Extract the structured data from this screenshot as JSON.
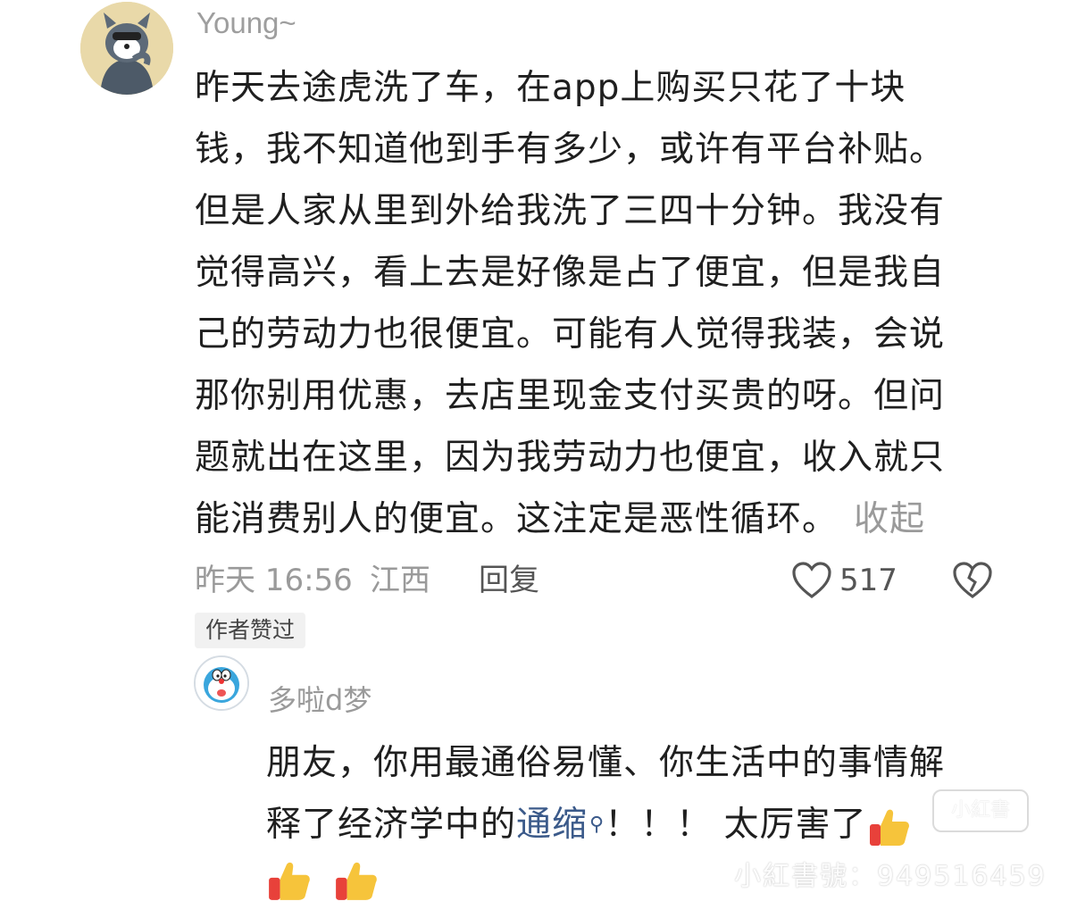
{
  "comment": {
    "username": "Young~",
    "lines": [
      "昨天去途虎洗了车，在app上购买只花了十块",
      "钱，我不知道他到手有多少，或许有平台补贴。",
      "但是人家从里到外给我洗了三四十分钟。我没有",
      "觉得高兴，看上去是好像是占了便宜，但是我自",
      "己的劳动力也很便宜。可能有人觉得我装，会说",
      "那你别用优惠，去店里现金支付买贵的呀。但问",
      "题就出在这里，因为我劳动力也便宜，收入就只",
      "能消费别人的便宜。这注定是恶性循环。"
    ],
    "collapse_label": "收起",
    "time": "昨天 16:56",
    "location": "江西",
    "reply_label": "回复",
    "like_count": "517",
    "author_liked_badge": "作者赞过",
    "avatar_icon": "cartoon-cat-avatar"
  },
  "reply": {
    "username": "多啦d梦",
    "line1": "朋友，你用最通俗易懂、你生活中的事情解",
    "line2_prefix": "释了经济学中的",
    "line2_link": "通缩",
    "line2_suffix": "！！！ 太厉害了",
    "avatar_icon": "doraemon-avatar",
    "emojis": [
      "thumbs-up-icon",
      "thumbs-up-icon",
      "thumbs-up-icon"
    ]
  },
  "watermark": {
    "text": "小紅書號：949516459",
    "logo_text": "小紅書"
  },
  "colors": {
    "text": "#1f1f1f",
    "muted": "#9a9a9a",
    "link": "#3b5a8a",
    "badge_bg": "#f1f1f1"
  }
}
